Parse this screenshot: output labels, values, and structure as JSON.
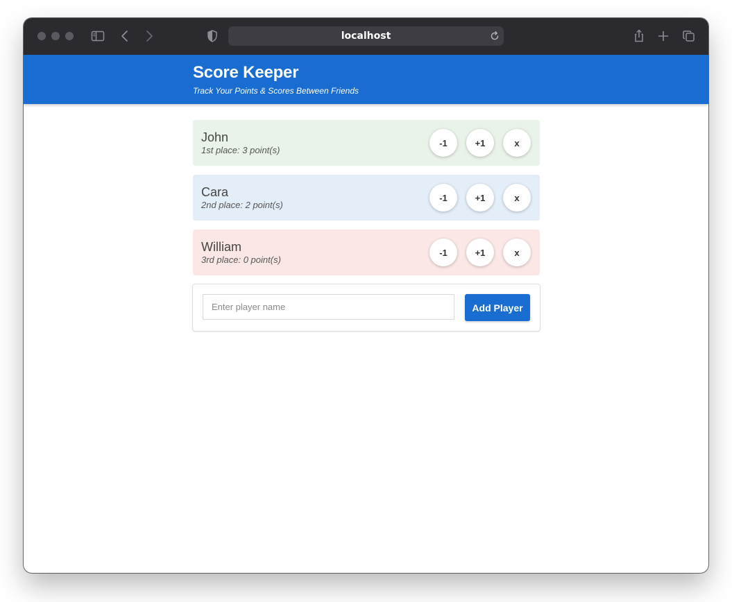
{
  "browser": {
    "url": "localhost"
  },
  "header": {
    "title": "Score Keeper",
    "subtitle": "Track Your Points & Scores Between Friends"
  },
  "players": [
    {
      "name": "John",
      "info": "1st place: 3 point(s)",
      "bg": "#eaf3e9"
    },
    {
      "name": "Cara",
      "info": "2nd place: 2 point(s)",
      "bg": "#e4eef9"
    },
    {
      "name": "William",
      "info": "3rd place: 0 point(s)",
      "bg": "#fbe8e6"
    }
  ],
  "controls": {
    "minus_label": "-1",
    "plus_label": "+1",
    "remove_label": "x"
  },
  "add_player": {
    "placeholder": "Enter player name",
    "value": "",
    "button_label": "Add Player"
  },
  "colors": {
    "accent": "#1a6dd0",
    "toolbar": "#2b2a2f"
  }
}
